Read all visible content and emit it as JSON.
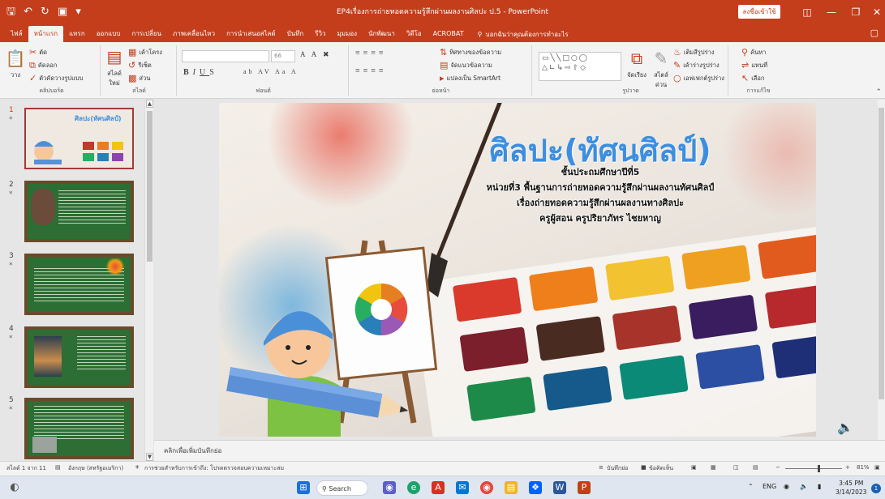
{
  "titlebar": {
    "title": "EP4เรื่องการถ่ายทอดความรู้สึกผ่านผลงานศิลปะ ป.5 - PowerPoint",
    "signin_label": "ลงชื่อเข้าใช้",
    "qat": [
      "save-icon",
      "undo-icon",
      "redo-icon",
      "present-icon",
      "customize-icon"
    ],
    "accent": "#c43e1c"
  },
  "ribbon_tabs": [
    "ไฟล์",
    "หน้าแรก",
    "แทรก",
    "ออกแบบ",
    "การเปลี่ยน",
    "ภาพเคลื่อนไหว",
    "การนำเสนอสไลด์",
    "บันทึก",
    "รีวิว",
    "มุมมอง",
    "นักพัฒนา",
    "วิดีโอ",
    "ACROBAT"
  ],
  "tell_me": "บอกฉันว่าคุณต้องการทำอะไร",
  "ribbon": {
    "clipboard": {
      "paste": "วาง",
      "cut": "ตัด",
      "copy": "คัดลอก",
      "format_painter": "ตัวคัดวางรูปแบบ",
      "label": "คลิปบอร์ด"
    },
    "slides": {
      "new_slide": "สไลด์ ใหม่",
      "layout": "เค้าโครง",
      "reset": "รีเซ็ต",
      "section": "ส่วน",
      "label": "สไลด์"
    },
    "font": {
      "size": "66",
      "label": "ฟอนต์"
    },
    "paragraph": {
      "text_direction": "ทิศทางของข้อความ",
      "align_text": "จัดแนวข้อความ",
      "smartart": "แปลงเป็น SmartArt",
      "label": "ย่อหน้า"
    },
    "drawing": {
      "arrange": "จัดเรียง",
      "quick_styles": "สไตล์ ด่วน",
      "fill": "เติมสีรูปร่าง",
      "outline": "เค้าร่างรูปร่าง",
      "effects": "เอฟเฟกต์รูปร่าง",
      "label": "รูปวาด"
    },
    "editing": {
      "find": "ค้นหา",
      "replace": "แทนที่",
      "select": "เลือก",
      "label": "การแก้ไข"
    }
  },
  "thumbnails": [
    {
      "num": "1",
      "star": "*"
    },
    {
      "num": "2",
      "star": "*"
    },
    {
      "num": "3",
      "star": "*"
    },
    {
      "num": "4",
      "star": "*"
    },
    {
      "num": "5",
      "star": "*"
    }
  ],
  "slide": {
    "title": "ศิลปะ(ทัศนศิลป์)",
    "lines": [
      "ชั้นประถมศึกษาปีที่5",
      "หน่วยที่3 พื้นฐานการถ่ายทอดความรู้สึกผ่านผลงานทัศนศิลป์",
      "เรื่องถ่ายทอดความรู้สึกผ่านผลงานทางศิลปะ",
      "ครูผู้สอน ครูปริยาภัทร ไชยหาญ"
    ],
    "title_color": "#3c8ee0"
  },
  "notes_placeholder": "คลิกเพื่อเพิ่มบันทึกย่อ",
  "status": {
    "slide_count": "สไลด์ 1 จาก 11",
    "language": "อังกฤษ (สหรัฐอเมริกา)",
    "accessibility": "การช่วยสำหรับการเข้าถึง: โปรดตรวจสอบความเหมาะสม",
    "notes": "บันทึกย่อ",
    "comments": "ข้อคิดเห็น",
    "zoom": "81%"
  },
  "taskbar": {
    "search": "Search",
    "lang": "ENG",
    "time": "3:45 PM",
    "date": "3/14/2023",
    "notifications": "1"
  }
}
